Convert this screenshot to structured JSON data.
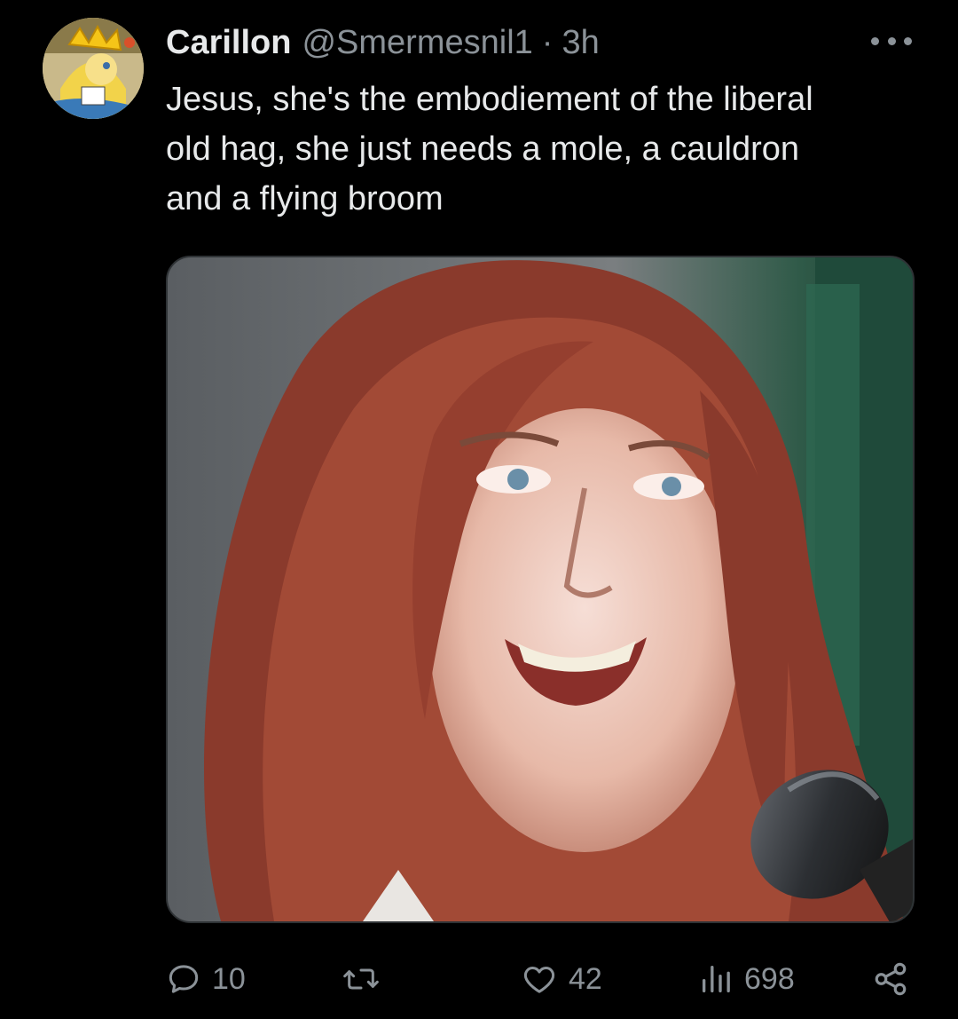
{
  "author": {
    "display_name": "Carillon",
    "handle": "@Smermesnil1",
    "separator": "·",
    "time": "3h",
    "avatar_icon": "cartoon-avatar"
  },
  "tweet": {
    "text_lines": [
      "Jesus, she's the embodiement of the liberal",
      "old hag, she just needs a mole, a cauldron",
      "and a flying broom"
    ],
    "media_icon": "photo-woman-smiling-with-microphone"
  },
  "actions": {
    "reply_count": "10",
    "retweet_count": "",
    "like_count": "42",
    "views_count": "698"
  },
  "colors": {
    "background": "#000000",
    "text_primary": "#e7e9ea",
    "text_secondary": "#8b9298"
  }
}
